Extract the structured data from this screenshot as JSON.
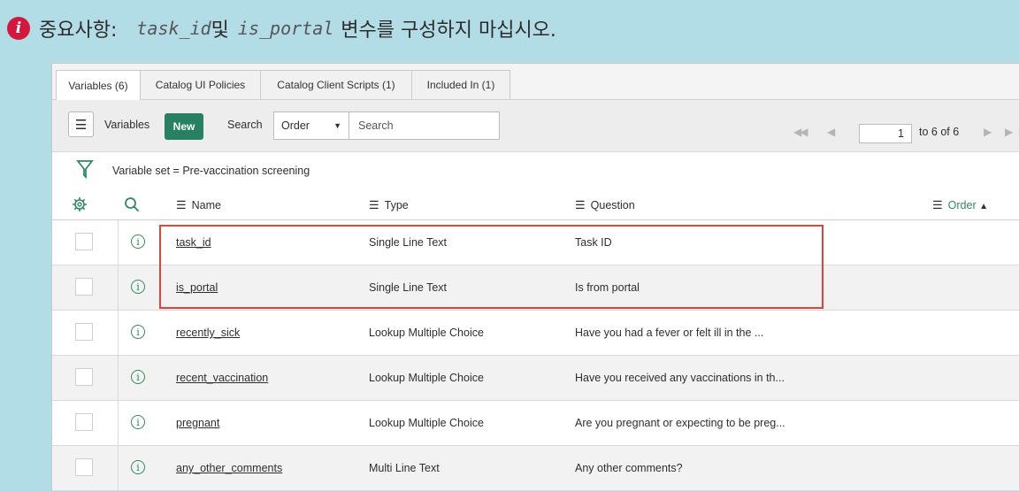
{
  "note": {
    "prefix": "중요사항:",
    "code1": "task_id",
    "joiner": "및",
    "code2": "is_portal",
    "suffix": "변수를 구성하지 마십시오."
  },
  "tabs": [
    {
      "label": "Variables (6)",
      "active": true
    },
    {
      "label": "Catalog UI Policies"
    },
    {
      "label": "Catalog Client Scripts (1)"
    },
    {
      "label": "Included In (1)"
    }
  ],
  "toolbar": {
    "list_label": "Variables",
    "new_label": "New",
    "search_label": "Search",
    "search_field": "Order",
    "search_placeholder": "Search",
    "page_value": "1",
    "range_text": "to 6 of 6"
  },
  "filter_text": "Variable set = Pre-vaccination screening",
  "columns": {
    "name": "Name",
    "type": "Type",
    "question": "Question",
    "order": "Order"
  },
  "rows": [
    {
      "name": "task_id",
      "type": "Single Line Text",
      "question": "Task ID"
    },
    {
      "name": "is_portal",
      "type": "Single Line Text",
      "question": "Is from portal"
    },
    {
      "name": "recently_sick",
      "type": "Lookup Multiple Choice",
      "question": "Have you had a fever or felt ill in the ..."
    },
    {
      "name": "recent_vaccination",
      "type": "Lookup Multiple Choice",
      "question": "Have you received any vaccinations in th..."
    },
    {
      "name": "pregnant",
      "type": "Lookup Multiple Choice",
      "question": "Are you pregnant or expecting to be preg..."
    },
    {
      "name": "any_other_comments",
      "type": "Multi Line Text",
      "question": "Any other comments?"
    }
  ],
  "colors": {
    "new_button": "#278061",
    "highlight": "#e0423d",
    "note_bg": "#b3dde6",
    "info_badge": "#d4183d"
  }
}
